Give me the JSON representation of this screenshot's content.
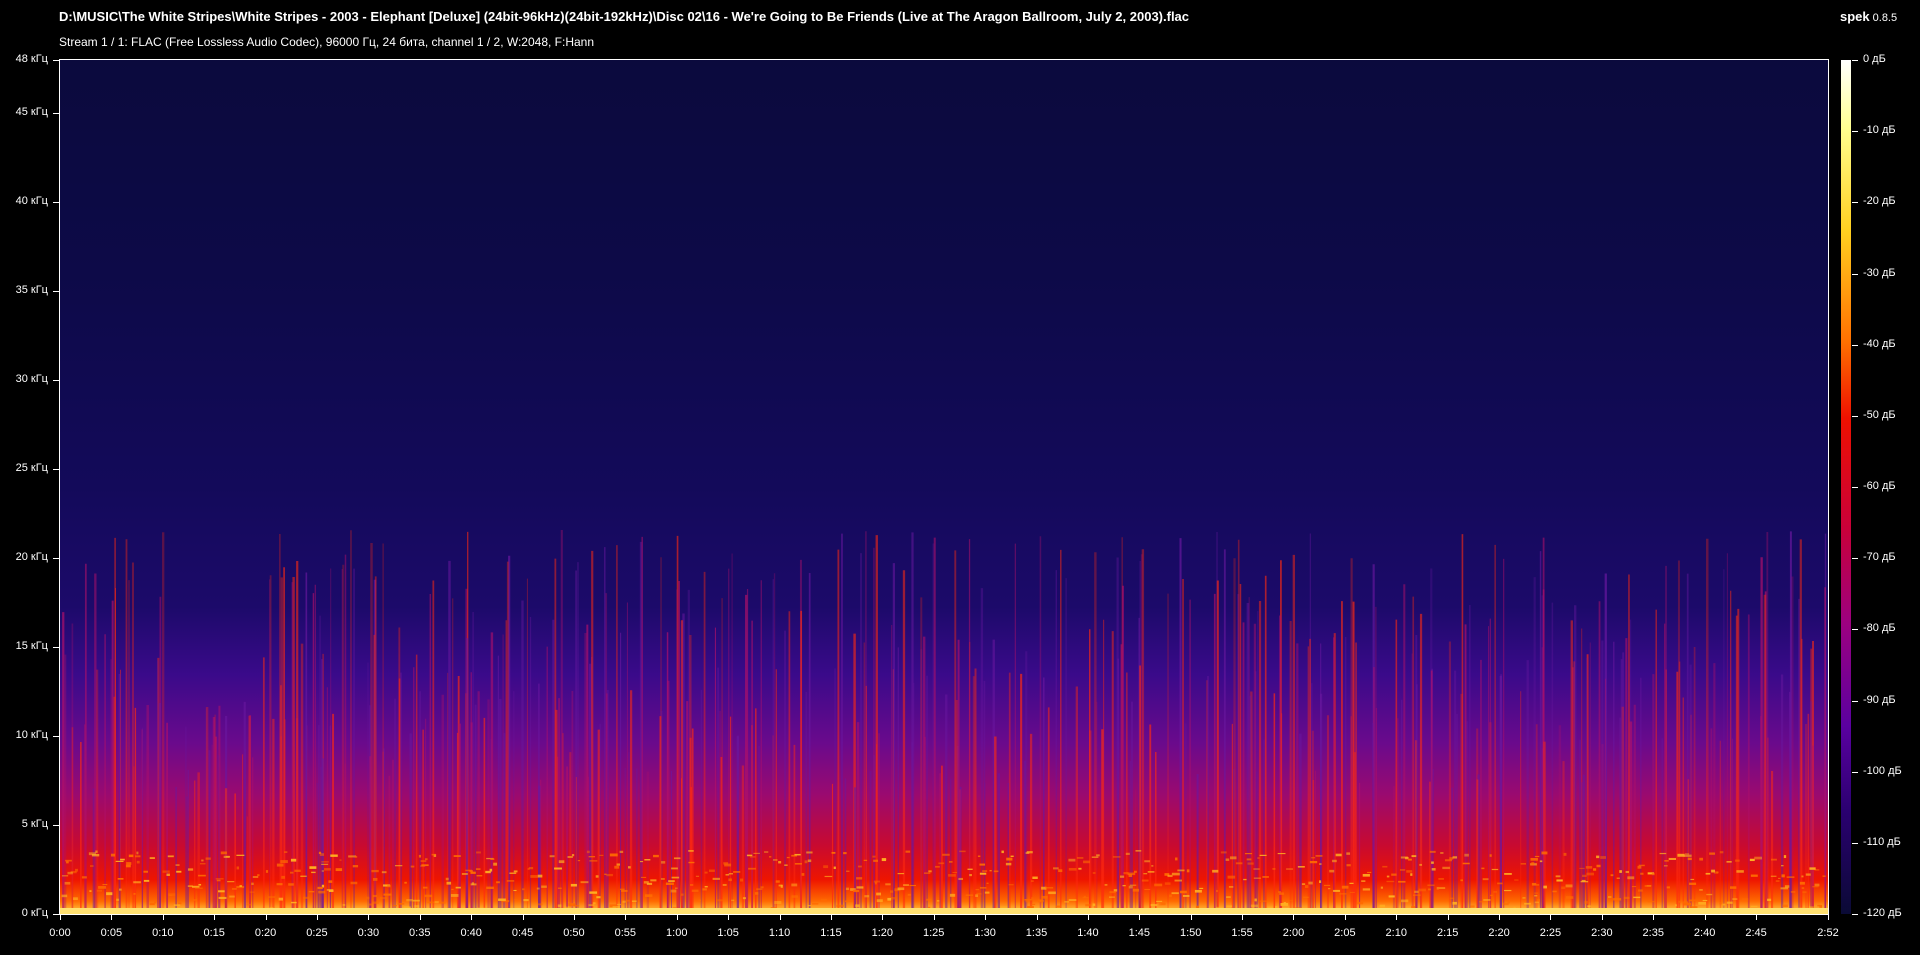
{
  "header": {
    "file_path": "D:\\MUSIC\\The White Stripes\\White Stripes - 2003 - Elephant [Deluxe] (24bit-96kHz)(24bit-192kHz)\\Disc 02\\16 - We're Going to Be Friends (Live at The Aragon Ballroom, July 2, 2003).flac",
    "stream_info": "Stream 1 / 1: FLAC (Free Lossless Audio Codec), 96000 Гц, 24 бита, channel 1 / 2, W:2048, F:Hann",
    "app_name": "spek",
    "app_version": "0.8.5"
  },
  "colors": {
    "background": "#000000",
    "text": "#ffffff"
  },
  "chart_data": {
    "type": "heatmap",
    "title": "",
    "xlabel": "",
    "ylabel": "",
    "x_range_seconds": [
      0,
      172
    ],
    "y_range_khz": [
      0,
      48
    ],
    "y_ticks": [
      {
        "value": 0,
        "label": "0 кГц"
      },
      {
        "value": 5,
        "label": "5 кГц"
      },
      {
        "value": 10,
        "label": "10 кГц"
      },
      {
        "value": 15,
        "label": "15 кГц"
      },
      {
        "value": 20,
        "label": "20 кГц"
      },
      {
        "value": 25,
        "label": "25 кГц"
      },
      {
        "value": 30,
        "label": "30 кГц"
      },
      {
        "value": 35,
        "label": "35 кГц"
      },
      {
        "value": 40,
        "label": "40 кГц"
      },
      {
        "value": 45,
        "label": "45 кГц"
      },
      {
        "value": 48,
        "label": "48 кГц"
      }
    ],
    "x_ticks": [
      {
        "value": 0,
        "label": "0:00"
      },
      {
        "value": 5,
        "label": "0:05"
      },
      {
        "value": 10,
        "label": "0:10"
      },
      {
        "value": 15,
        "label": "0:15"
      },
      {
        "value": 20,
        "label": "0:20"
      },
      {
        "value": 25,
        "label": "0:25"
      },
      {
        "value": 30,
        "label": "0:30"
      },
      {
        "value": 35,
        "label": "0:35"
      },
      {
        "value": 40,
        "label": "0:40"
      },
      {
        "value": 45,
        "label": "0:45"
      },
      {
        "value": 50,
        "label": "0:50"
      },
      {
        "value": 55,
        "label": "0:55"
      },
      {
        "value": 60,
        "label": "1:00"
      },
      {
        "value": 65,
        "label": "1:05"
      },
      {
        "value": 70,
        "label": "1:10"
      },
      {
        "value": 75,
        "label": "1:15"
      },
      {
        "value": 80,
        "label": "1:20"
      },
      {
        "value": 85,
        "label": "1:25"
      },
      {
        "value": 90,
        "label": "1:30"
      },
      {
        "value": 95,
        "label": "1:35"
      },
      {
        "value": 100,
        "label": "1:40"
      },
      {
        "value": 105,
        "label": "1:45"
      },
      {
        "value": 110,
        "label": "1:50"
      },
      {
        "value": 115,
        "label": "1:55"
      },
      {
        "value": 120,
        "label": "2:00"
      },
      {
        "value": 125,
        "label": "2:05"
      },
      {
        "value": 130,
        "label": "2:10"
      },
      {
        "value": 135,
        "label": "2:15"
      },
      {
        "value": 140,
        "label": "2:20"
      },
      {
        "value": 145,
        "label": "2:25"
      },
      {
        "value": 150,
        "label": "2:30"
      },
      {
        "value": 155,
        "label": "2:35"
      },
      {
        "value": 160,
        "label": "2:40"
      },
      {
        "value": 165,
        "label": "2:45"
      },
      {
        "value": 172,
        "label": "2:52"
      }
    ],
    "colorbar_ticks": [
      {
        "value": 0,
        "label": "0 дБ"
      },
      {
        "value": -10,
        "label": "-10 дБ"
      },
      {
        "value": -20,
        "label": "-20 дБ"
      },
      {
        "value": -30,
        "label": "-30 дБ"
      },
      {
        "value": -40,
        "label": "-40 дБ"
      },
      {
        "value": -50,
        "label": "-50 дБ"
      },
      {
        "value": -60,
        "label": "-60 дБ"
      },
      {
        "value": -70,
        "label": "-70 дБ"
      },
      {
        "value": -80,
        "label": "-80 дБ"
      },
      {
        "value": -90,
        "label": "-90 дБ"
      },
      {
        "value": -100,
        "label": "-100 дБ"
      },
      {
        "value": -110,
        "label": "-110 дБ"
      },
      {
        "value": -120,
        "label": "-120 дБ"
      }
    ],
    "colorbar_range_db": [
      -120,
      0
    ]
  }
}
